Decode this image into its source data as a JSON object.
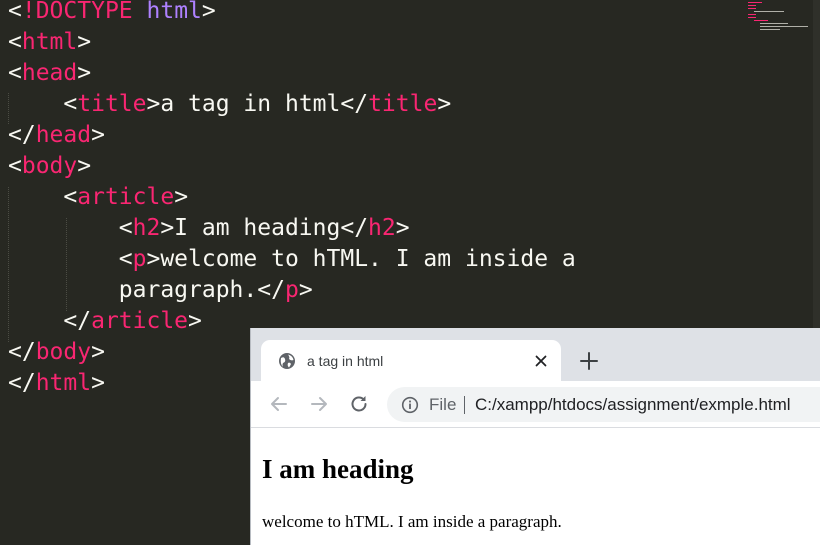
{
  "editor": {
    "lines": [
      [
        {
          "t": "<",
          "c": "p"
        },
        {
          "t": "!DOCTYPE",
          "c": "t"
        },
        {
          "t": " ",
          "c": "p"
        },
        {
          "t": "html",
          "c": "k"
        },
        {
          "t": ">",
          "c": "p"
        }
      ],
      [
        {
          "t": "<",
          "c": "p"
        },
        {
          "t": "html",
          "c": "t"
        },
        {
          "t": ">",
          "c": "p"
        }
      ],
      [
        {
          "t": "<",
          "c": "p"
        },
        {
          "t": "head",
          "c": "t"
        },
        {
          "t": ">",
          "c": "p"
        }
      ],
      [
        {
          "t": "    <",
          "c": "p"
        },
        {
          "t": "title",
          "c": "t"
        },
        {
          "t": ">a tag in html</",
          "c": "p"
        },
        {
          "t": "title",
          "c": "t"
        },
        {
          "t": ">",
          "c": "p"
        }
      ],
      [
        {
          "t": "</",
          "c": "p"
        },
        {
          "t": "head",
          "c": "t"
        },
        {
          "t": ">",
          "c": "p"
        }
      ],
      [
        {
          "t": "<",
          "c": "p"
        },
        {
          "t": "body",
          "c": "t"
        },
        {
          "t": ">",
          "c": "p"
        }
      ],
      [
        {
          "t": "    <",
          "c": "p"
        },
        {
          "t": "article",
          "c": "t"
        },
        {
          "t": ">",
          "c": "p"
        }
      ],
      [
        {
          "t": "        <",
          "c": "p"
        },
        {
          "t": "h2",
          "c": "t"
        },
        {
          "t": ">I am heading</",
          "c": "p"
        },
        {
          "t": "h2",
          "c": "t"
        },
        {
          "t": ">",
          "c": "p"
        }
      ],
      [
        {
          "t": "        <",
          "c": "p"
        },
        {
          "t": "p",
          "c": "t"
        },
        {
          "t": ">welcome to hTML. I am inside a",
          "c": "p"
        }
      ],
      [
        {
          "t": "        paragraph.</",
          "c": "p"
        },
        {
          "t": "p",
          "c": "t"
        },
        {
          "t": ">",
          "c": "p"
        }
      ],
      [
        {
          "t": "    </",
          "c": "p"
        },
        {
          "t": "article",
          "c": "t"
        },
        {
          "t": ">",
          "c": "p"
        }
      ],
      [
        {
          "t": "</",
          "c": "p"
        },
        {
          "t": "body",
          "c": "t"
        },
        {
          "t": ">",
          "c": "p"
        }
      ],
      [
        {
          "t": "</",
          "c": "p"
        },
        {
          "t": "html",
          "c": "t"
        },
        {
          "t": ">",
          "c": "p"
        }
      ]
    ],
    "colors": {
      "background": "#272822",
      "plain": "#f8f8f2",
      "tag": "#f92672",
      "keyword": "#ae81ff"
    }
  },
  "browser": {
    "tab": {
      "title": "a tag in html",
      "favicon": "globe-icon",
      "close_icon": "close-icon"
    },
    "new_tab_icon": "plus-icon",
    "toolbar": {
      "back_icon": "arrow-left-icon",
      "forward_icon": "arrow-right-icon",
      "reload_icon": "reload-icon",
      "info_icon": "info-icon",
      "scheme_label": "File",
      "url": "C:/xampp/htdocs/assignment/exmple.html"
    },
    "page": {
      "heading": "I am heading",
      "paragraph": "welcome to hTML. I am inside a paragraph."
    }
  }
}
